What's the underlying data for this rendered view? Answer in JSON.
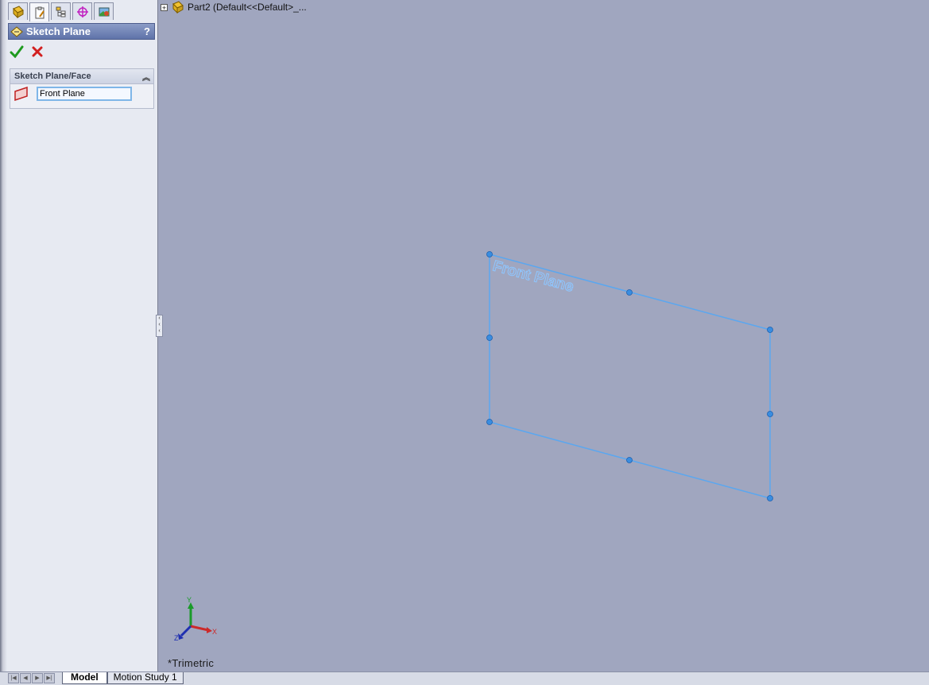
{
  "manager_tabs": [
    {
      "icon": "feature-manager-icon",
      "active": false
    },
    {
      "icon": "property-manager-icon",
      "active": true
    },
    {
      "icon": "configuration-manager-icon",
      "active": false
    },
    {
      "icon": "dimxpert-manager-icon",
      "active": false
    },
    {
      "icon": "display-manager-icon",
      "active": false
    }
  ],
  "property_manager": {
    "title": "Sketch Plane",
    "help": "?",
    "ok_icon": "checkmark-icon",
    "cancel_icon": "close-icon",
    "group": {
      "label": "Sketch Plane/Face",
      "collapse": "︽",
      "plane_icon": "plane-icon",
      "selection": "Front Plane"
    }
  },
  "feature_tree": {
    "expander": "+",
    "part_label": "Part2  (Default<<Default>_..."
  },
  "viewport": {
    "plane_label": "Front Plane",
    "view_name": "*Trimetric",
    "triad": {
      "x": "X",
      "y": "Y",
      "z": "Z"
    }
  },
  "bottom_tabs": [
    {
      "label": "Model",
      "active": true
    },
    {
      "label": "Motion Study 1",
      "active": false
    }
  ],
  "colors": {
    "viewport_bg": "#a0a6bf",
    "plane_outline": "#5aa7f0",
    "handle": "#2f7fd6",
    "ok_green": "#1e9a1e",
    "cancel_red": "#d21f1f"
  }
}
